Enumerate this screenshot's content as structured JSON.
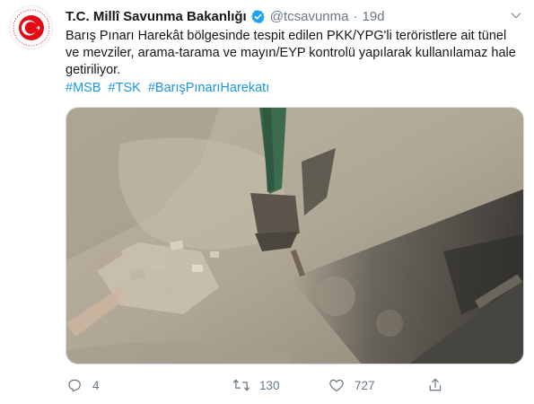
{
  "tweet": {
    "author_name": "T.C. Millî Savunma Bakanlığı",
    "handle": "@tcsavunma",
    "separator": "·",
    "time": "19d",
    "text": "Barış Pınarı Harekât bölgesinde tespit edilen PKK/YPG'li teröristlere ait tünel ve mevziler, arama-tarama ve mayın/EYP kontrolü yapılarak kullanılamaz hale getiriliyor.",
    "hashtags": [
      "#MSB",
      "#TSK",
      "#BarışPınarıHarekatı"
    ]
  },
  "actions": {
    "reply_count": "4",
    "retweet_count": "130",
    "like_count": "727"
  },
  "colors": {
    "brand_red": "#e30a17",
    "verified_blue": "#1da1f2",
    "link_blue": "#1b95e0",
    "muted_gray": "#657786"
  },
  "icons": {
    "avatar": "turkish-crescent-star-emblem",
    "verified": "verified-badge-icon",
    "more": "chevron-down-icon",
    "reply": "reply-icon",
    "retweet": "retweet-icon",
    "like": "heart-icon",
    "share": "share-icon"
  }
}
